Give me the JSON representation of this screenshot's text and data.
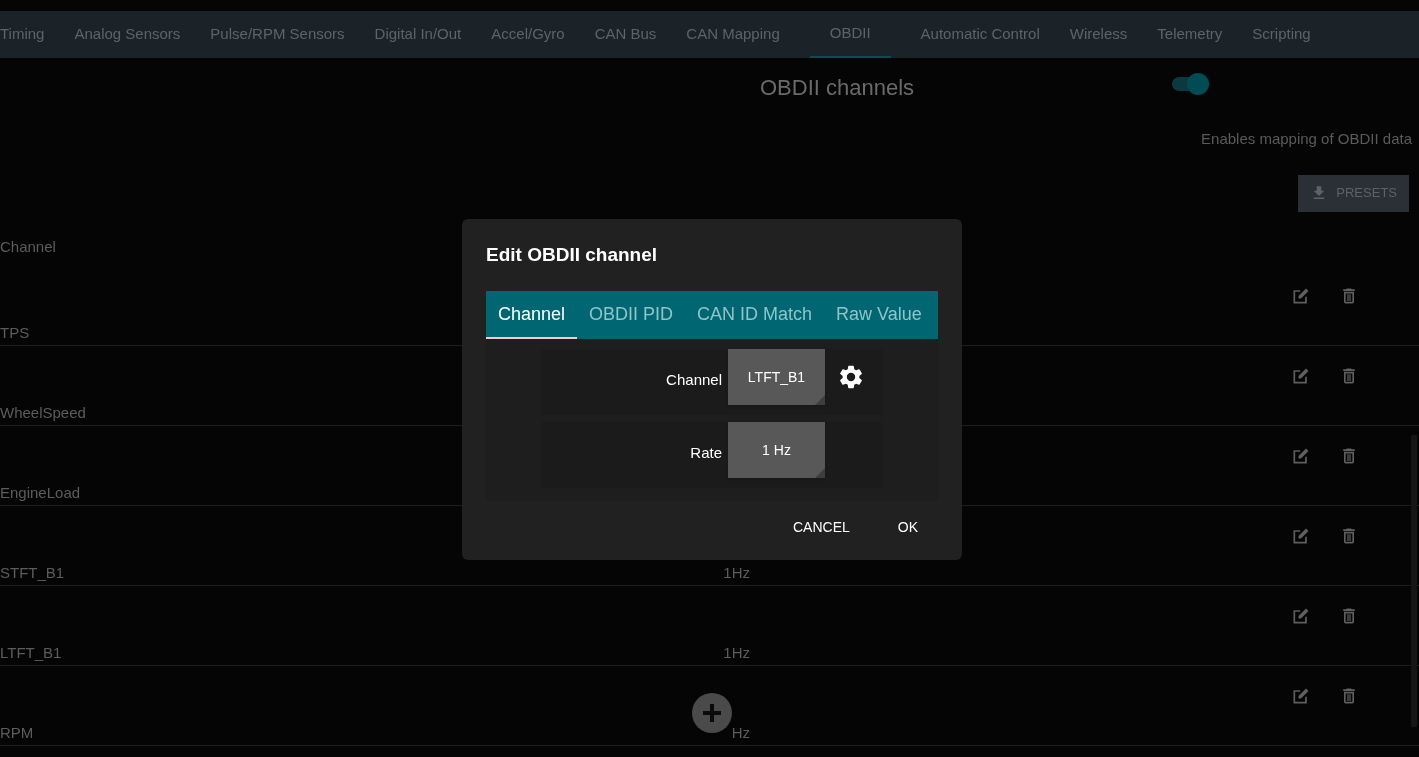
{
  "tabs": [
    {
      "label": "Timing",
      "selected": false
    },
    {
      "label": "Analog Sensors",
      "selected": false
    },
    {
      "label": "Pulse/RPM Sensors",
      "selected": false
    },
    {
      "label": "Digital In/Out",
      "selected": false
    },
    {
      "label": "Accel/Gyro",
      "selected": false
    },
    {
      "label": "CAN Bus",
      "selected": false
    },
    {
      "label": "CAN Mapping",
      "selected": false
    },
    {
      "label": "OBDII",
      "selected": true
    },
    {
      "label": "Automatic Control",
      "selected": false
    },
    {
      "label": "Wireless",
      "selected": false
    },
    {
      "label": "Telemetry",
      "selected": false
    },
    {
      "label": "Scripting",
      "selected": false
    }
  ],
  "section": {
    "title": "OBDII channels",
    "enabled": true,
    "hint": "Enables mapping of OBDII data",
    "presets_button": "PRESETS"
  },
  "table": {
    "columns": [
      "Channel"
    ],
    "rows": [
      {
        "channel": "TPS"
      },
      {
        "channel": "WheelSpeed"
      },
      {
        "channel": "EngineLoad"
      },
      {
        "channel": "STFT_B1",
        "rate": "1Hz"
      },
      {
        "channel": "LTFT_B1",
        "rate": "1Hz"
      },
      {
        "channel": "RPM",
        "rate": "Hz"
      }
    ]
  },
  "dialog": {
    "title": "Edit OBDII channel",
    "tabs": [
      {
        "label": "Channel",
        "selected": true
      },
      {
        "label": "OBDII PID",
        "selected": false
      },
      {
        "label": "CAN ID Match",
        "selected": false
      },
      {
        "label": "Raw Value",
        "selected": false
      }
    ],
    "fields": [
      {
        "label": "Channel",
        "value": "LTFT_B1",
        "settings": true
      },
      {
        "label": "Rate",
        "value": "1 Hz",
        "settings": false
      }
    ],
    "buttons": [
      "CANCEL",
      "OK"
    ]
  }
}
